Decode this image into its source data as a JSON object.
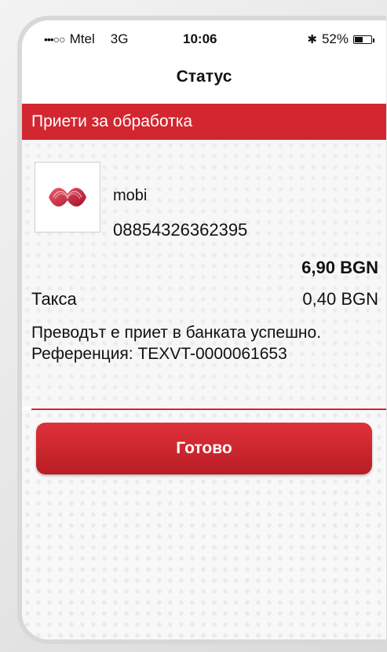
{
  "status_bar": {
    "signal": "•••○○",
    "carrier": "Mtel",
    "network": "3G",
    "time": "10:06",
    "bluetooth": "✱",
    "battery_percent_text": "52%",
    "battery_level": 0.52
  },
  "nav": {
    "title": "Статус"
  },
  "section": {
    "header": "Приети за обработка"
  },
  "payment": {
    "merchant_name": "mobi",
    "merchant_id": "08854326362395",
    "amount": "6,90 BGN",
    "fee_label": "Такса",
    "fee_value": "0,40 BGN",
    "message_line1": "Преводът е приет в банката успешно.",
    "message_line2": "Референция: TEXVT-0000061653"
  },
  "actions": {
    "done_label": "Готово"
  },
  "colors": {
    "accent": "#d22730"
  },
  "icons": {
    "merchant_logo": "mtel-logo-icon"
  }
}
